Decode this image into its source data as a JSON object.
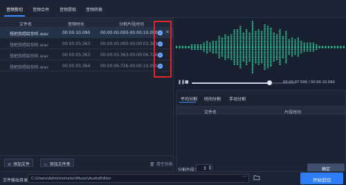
{
  "tabs": [
    {
      "label": "音频剪切",
      "active": true
    },
    {
      "label": "音频合并",
      "active": false
    },
    {
      "label": "音频提取",
      "active": false
    },
    {
      "label": "音频转换",
      "active": false
    }
  ],
  "file_table": {
    "columns": [
      "文件名",
      "音频时长",
      "分割片段时间"
    ],
    "rows": [
      {
        "name": "想把我唱给你听.wav",
        "duration": "00:00:10.090",
        "segment": "00:00:00.000-00:00:10.090",
        "selected": true
      },
      {
        "name": "想把我唱给你听.wav",
        "duration": "00:00:03.363",
        "segment": "00:00:00.000-00:00:03.363",
        "selected": false
      },
      {
        "name": "想把我唱给你听.wav",
        "duration": "00:00:03.363",
        "segment": "00:00:03.363-00:00:06.726",
        "selected": false
      },
      {
        "name": "想把我唱给你听.wav",
        "duration": "00:00:03.364",
        "segment": "00:00:06.726-00:00:10.090",
        "selected": false
      }
    ],
    "remove_icon": "×"
  },
  "left_footer": {
    "add_file": "添加文件",
    "add_folder": "添加文件夹",
    "clear_list": "清空列表"
  },
  "player": {
    "play_icon": "❚❚",
    "stop_icon": "■",
    "time": "00:00:07.599 / 00:00:10.090",
    "progress": 0.75
  },
  "split": {
    "tabs": [
      "平均分割",
      "时间分割",
      "手动分割"
    ],
    "columns": [
      "文件名",
      "片段时间"
    ],
    "segments_label": "分割片段：",
    "segments_value": "3",
    "confirm": "确定"
  },
  "output": {
    "label": "文件输出目录：",
    "path": "C:\\Users\\Administrator\\Music\\AudioEditor",
    "browse": "···",
    "start": "开始剪切"
  },
  "colors": {
    "accent": "#2f7df6",
    "wave": "#2ec9a0",
    "highlight_box": "#e0262b"
  }
}
